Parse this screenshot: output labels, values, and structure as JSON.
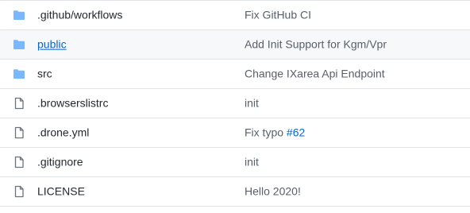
{
  "colors": {
    "folder_icon": "#79b8ff",
    "file_icon": "#6a737d",
    "link": "#0366d6",
    "border": "#e1e4e8",
    "hover_row": "#f6f8fa"
  },
  "files": [
    {
      "icon": "folder-icon",
      "name": ".github/workflows",
      "message": "Fix GitHub CI"
    },
    {
      "icon": "folder-icon",
      "name": "public",
      "message": "Add Init Support for Kgm/Vpr"
    },
    {
      "icon": "folder-icon",
      "name": "src",
      "message": "Change IXarea Api Endpoint"
    },
    {
      "icon": "file-icon",
      "name": ".browserslistrc",
      "message": "init"
    },
    {
      "icon": "file-icon",
      "name": ".drone.yml",
      "message": "Fix typo",
      "issue": "#62"
    },
    {
      "icon": "file-icon",
      "name": ".gitignore",
      "message": "init"
    },
    {
      "icon": "file-icon",
      "name": "LICENSE",
      "message": "Hello 2020!"
    }
  ]
}
